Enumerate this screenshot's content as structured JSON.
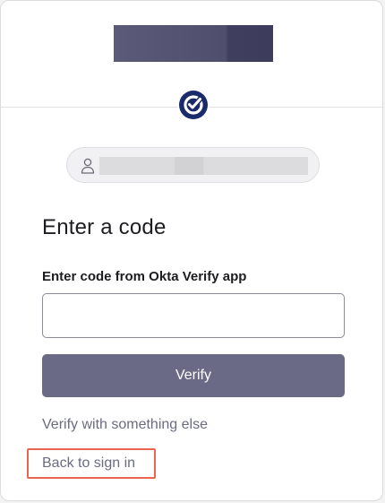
{
  "icons": {
    "factor": "okta-verify-icon",
    "user": "user-icon"
  },
  "colors": {
    "brand_navy": "#1a2b6b",
    "button_bg": "#6a6a86",
    "link_text": "#6b6b82",
    "highlight_border": "#e8664f"
  },
  "form": {
    "title": "Enter a code",
    "field_label": "Enter code from Okta Verify app",
    "code_value": "",
    "verify_label": "Verify"
  },
  "links": {
    "verify_other": "Verify with something else",
    "back_to_sign_in": "Back to sign in"
  }
}
